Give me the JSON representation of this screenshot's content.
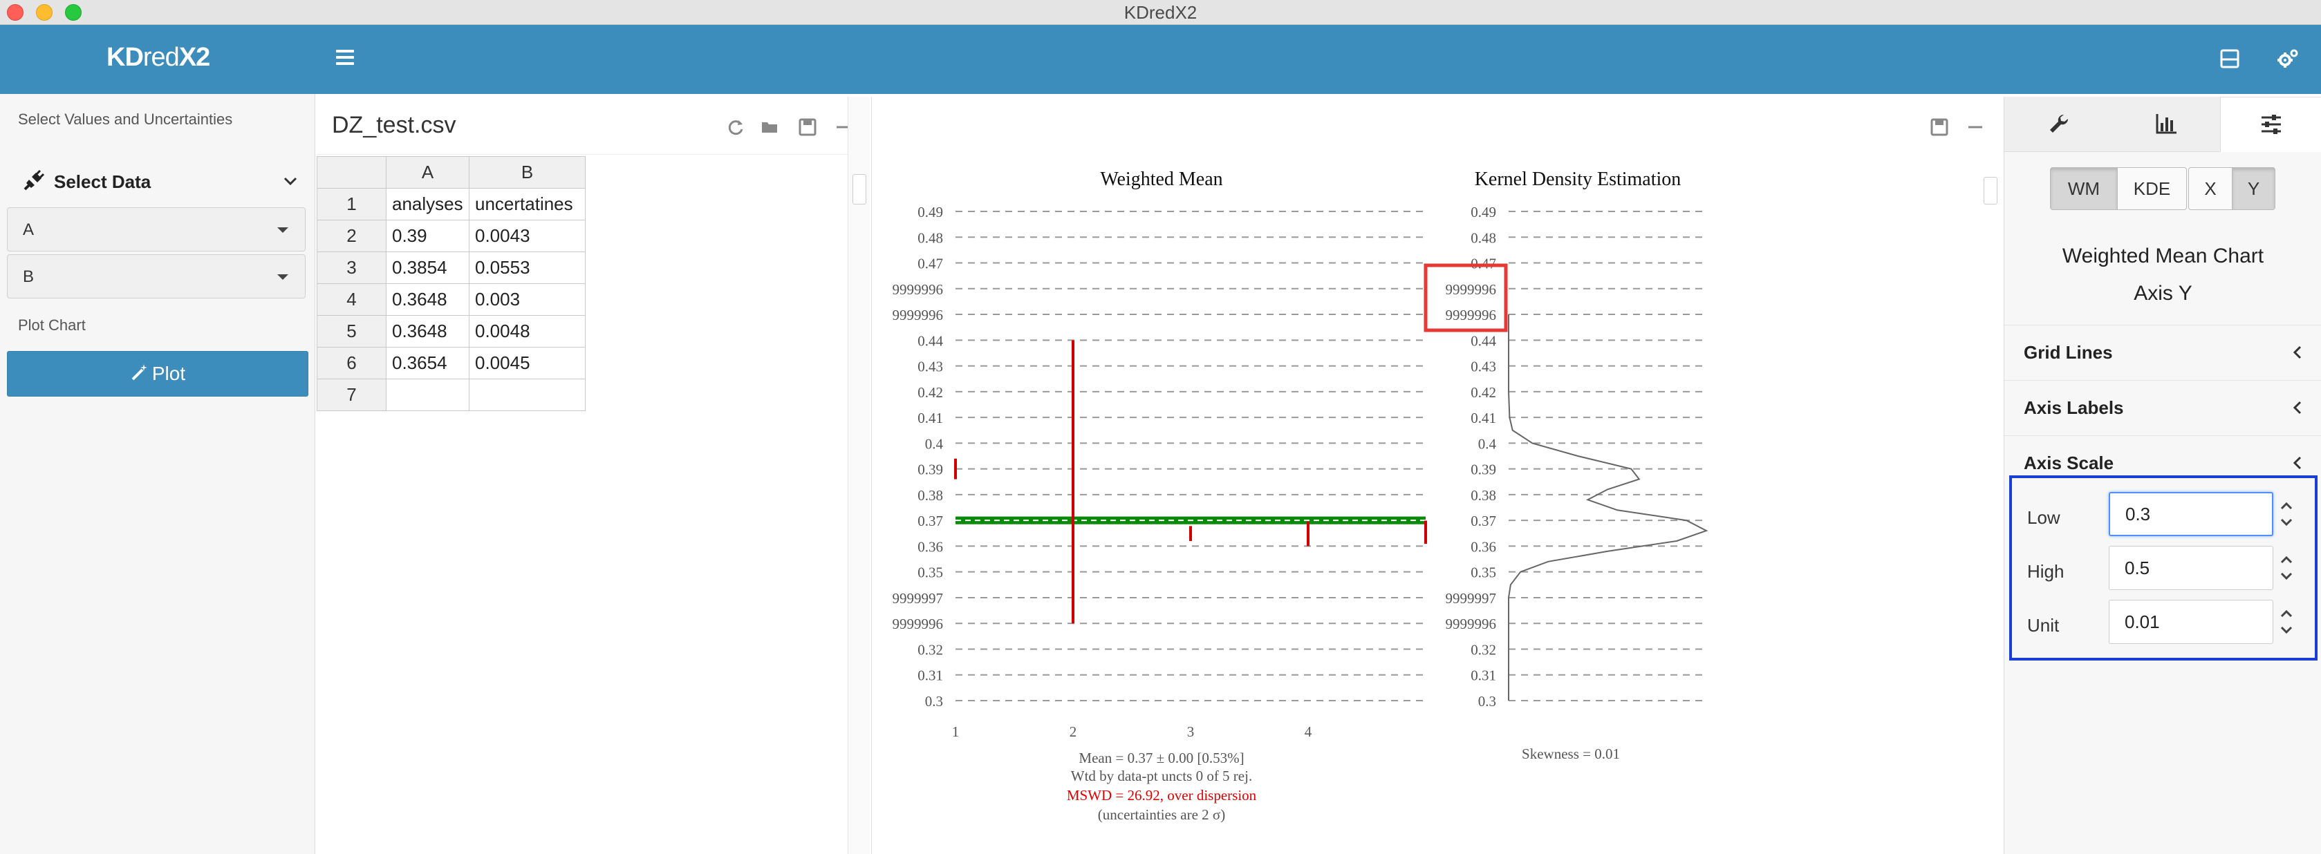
{
  "window": {
    "title": "KDredX2"
  },
  "header": {
    "logo_a": "KD",
    "logo_b": "red",
    "logo_c": "X2"
  },
  "sidebar": {
    "hint": "Select Values and Uncertainties",
    "section_label": "Select Data",
    "select_a": "A",
    "select_b": "B",
    "plot_label": "Plot Chart",
    "plot_button": "Plot"
  },
  "data_panel": {
    "file_name": "DZ_test.csv",
    "columns": [
      "A",
      "B"
    ],
    "rows": [
      [
        "1",
        "analyses",
        "uncertatines"
      ],
      [
        "2",
        "0.39",
        "0.0043"
      ],
      [
        "3",
        "0.3854",
        "0.0553"
      ],
      [
        "4",
        "0.3648",
        "0.003"
      ],
      [
        "5",
        "0.3648",
        "0.0048"
      ],
      [
        "6",
        "0.3654",
        "0.0045"
      ],
      [
        "7",
        "",
        ""
      ]
    ]
  },
  "chart_data": [
    {
      "type": "weighted-mean",
      "title": "Weighted Mean",
      "y_tick_labels": [
        "0.49",
        "0.48",
        "0.47",
        "9999996",
        "9999996",
        "0.44",
        "0.43",
        "0.42",
        "0.41",
        "0.4",
        "0.39",
        "0.38",
        "0.37",
        "0.36",
        "0.35",
        "9999997",
        "9999996",
        "0.32",
        "0.31",
        "0.3"
      ],
      "ylim": [
        0.3,
        0.49
      ],
      "x_tick_labels": [
        "1",
        "2",
        "3",
        "4"
      ],
      "analyses": [
        {
          "x": 1,
          "y": 0.39,
          "low": 0.386,
          "high": 0.394
        },
        {
          "x": 2,
          "y": 0.3854,
          "low": 0.33,
          "high": 0.44
        },
        {
          "x": 3,
          "y": 0.3648,
          "low": 0.362,
          "high": 0.3678
        },
        {
          "x": 4,
          "y": 0.3648,
          "low": 0.36,
          "high": 0.3696
        },
        {
          "x": 5,
          "y": 0.3654,
          "low": 0.3609,
          "high": 0.3699
        }
      ],
      "mean": 0.37,
      "mean_band": [
        0.3685,
        0.3715
      ],
      "line_color": "#d00000",
      "band_color": "#0a8a0a",
      "footer": [
        "Mean = 0.37 ± 0.00 [0.53%]",
        "Wtd by data-pt uncts 0 of 5 rej.",
        "MSWD = 26.92, over dispersion",
        "(uncertainties are 2 σ)"
      ],
      "mswd_color": "#e00000"
    },
    {
      "type": "kde",
      "title": "Kernel Density Estimation",
      "y_tick_labels": [
        "0.49",
        "0.48",
        "0.47",
        "9999996",
        "9999996",
        "0.44",
        "0.43",
        "0.42",
        "0.41",
        "0.4",
        "0.39",
        "0.38",
        "0.37",
        "0.36",
        "0.35",
        "9999997",
        "9999996",
        "0.32",
        "0.31",
        "0.3"
      ],
      "ylim": [
        0.3,
        0.49
      ],
      "density_curve": [
        [
          0.42,
          0
        ],
        [
          0.41,
          0.005
        ],
        [
          0.405,
          0.02
        ],
        [
          0.4,
          0.12
        ],
        [
          0.395,
          0.35
        ],
        [
          0.39,
          0.62
        ],
        [
          0.386,
          0.66
        ],
        [
          0.382,
          0.5
        ],
        [
          0.378,
          0.4
        ],
        [
          0.374,
          0.55
        ],
        [
          0.37,
          0.9
        ],
        [
          0.366,
          1.0
        ],
        [
          0.362,
          0.85
        ],
        [
          0.358,
          0.5
        ],
        [
          0.354,
          0.2
        ],
        [
          0.35,
          0.06
        ],
        [
          0.345,
          0.01
        ],
        [
          0.34,
          0
        ]
      ],
      "footer": "Skewness = 0.01"
    }
  ],
  "controls": {
    "chart_buttons": [
      "WM",
      "KDE"
    ],
    "axis_buttons": [
      "X",
      "Y"
    ],
    "chart_name": "Weighted Mean Chart",
    "axis_name": "Axis Y",
    "sections": [
      "Grid Lines",
      "Axis Labels",
      "Axis Scale"
    ],
    "scale": {
      "low_label": "Low",
      "low_value": "0.3",
      "high_label": "High",
      "high_value": "0.5",
      "unit_label": "Unit",
      "unit_value": "0.01"
    },
    "highlight_color": "#1a3fd4",
    "annotation_color": "#e53935"
  }
}
